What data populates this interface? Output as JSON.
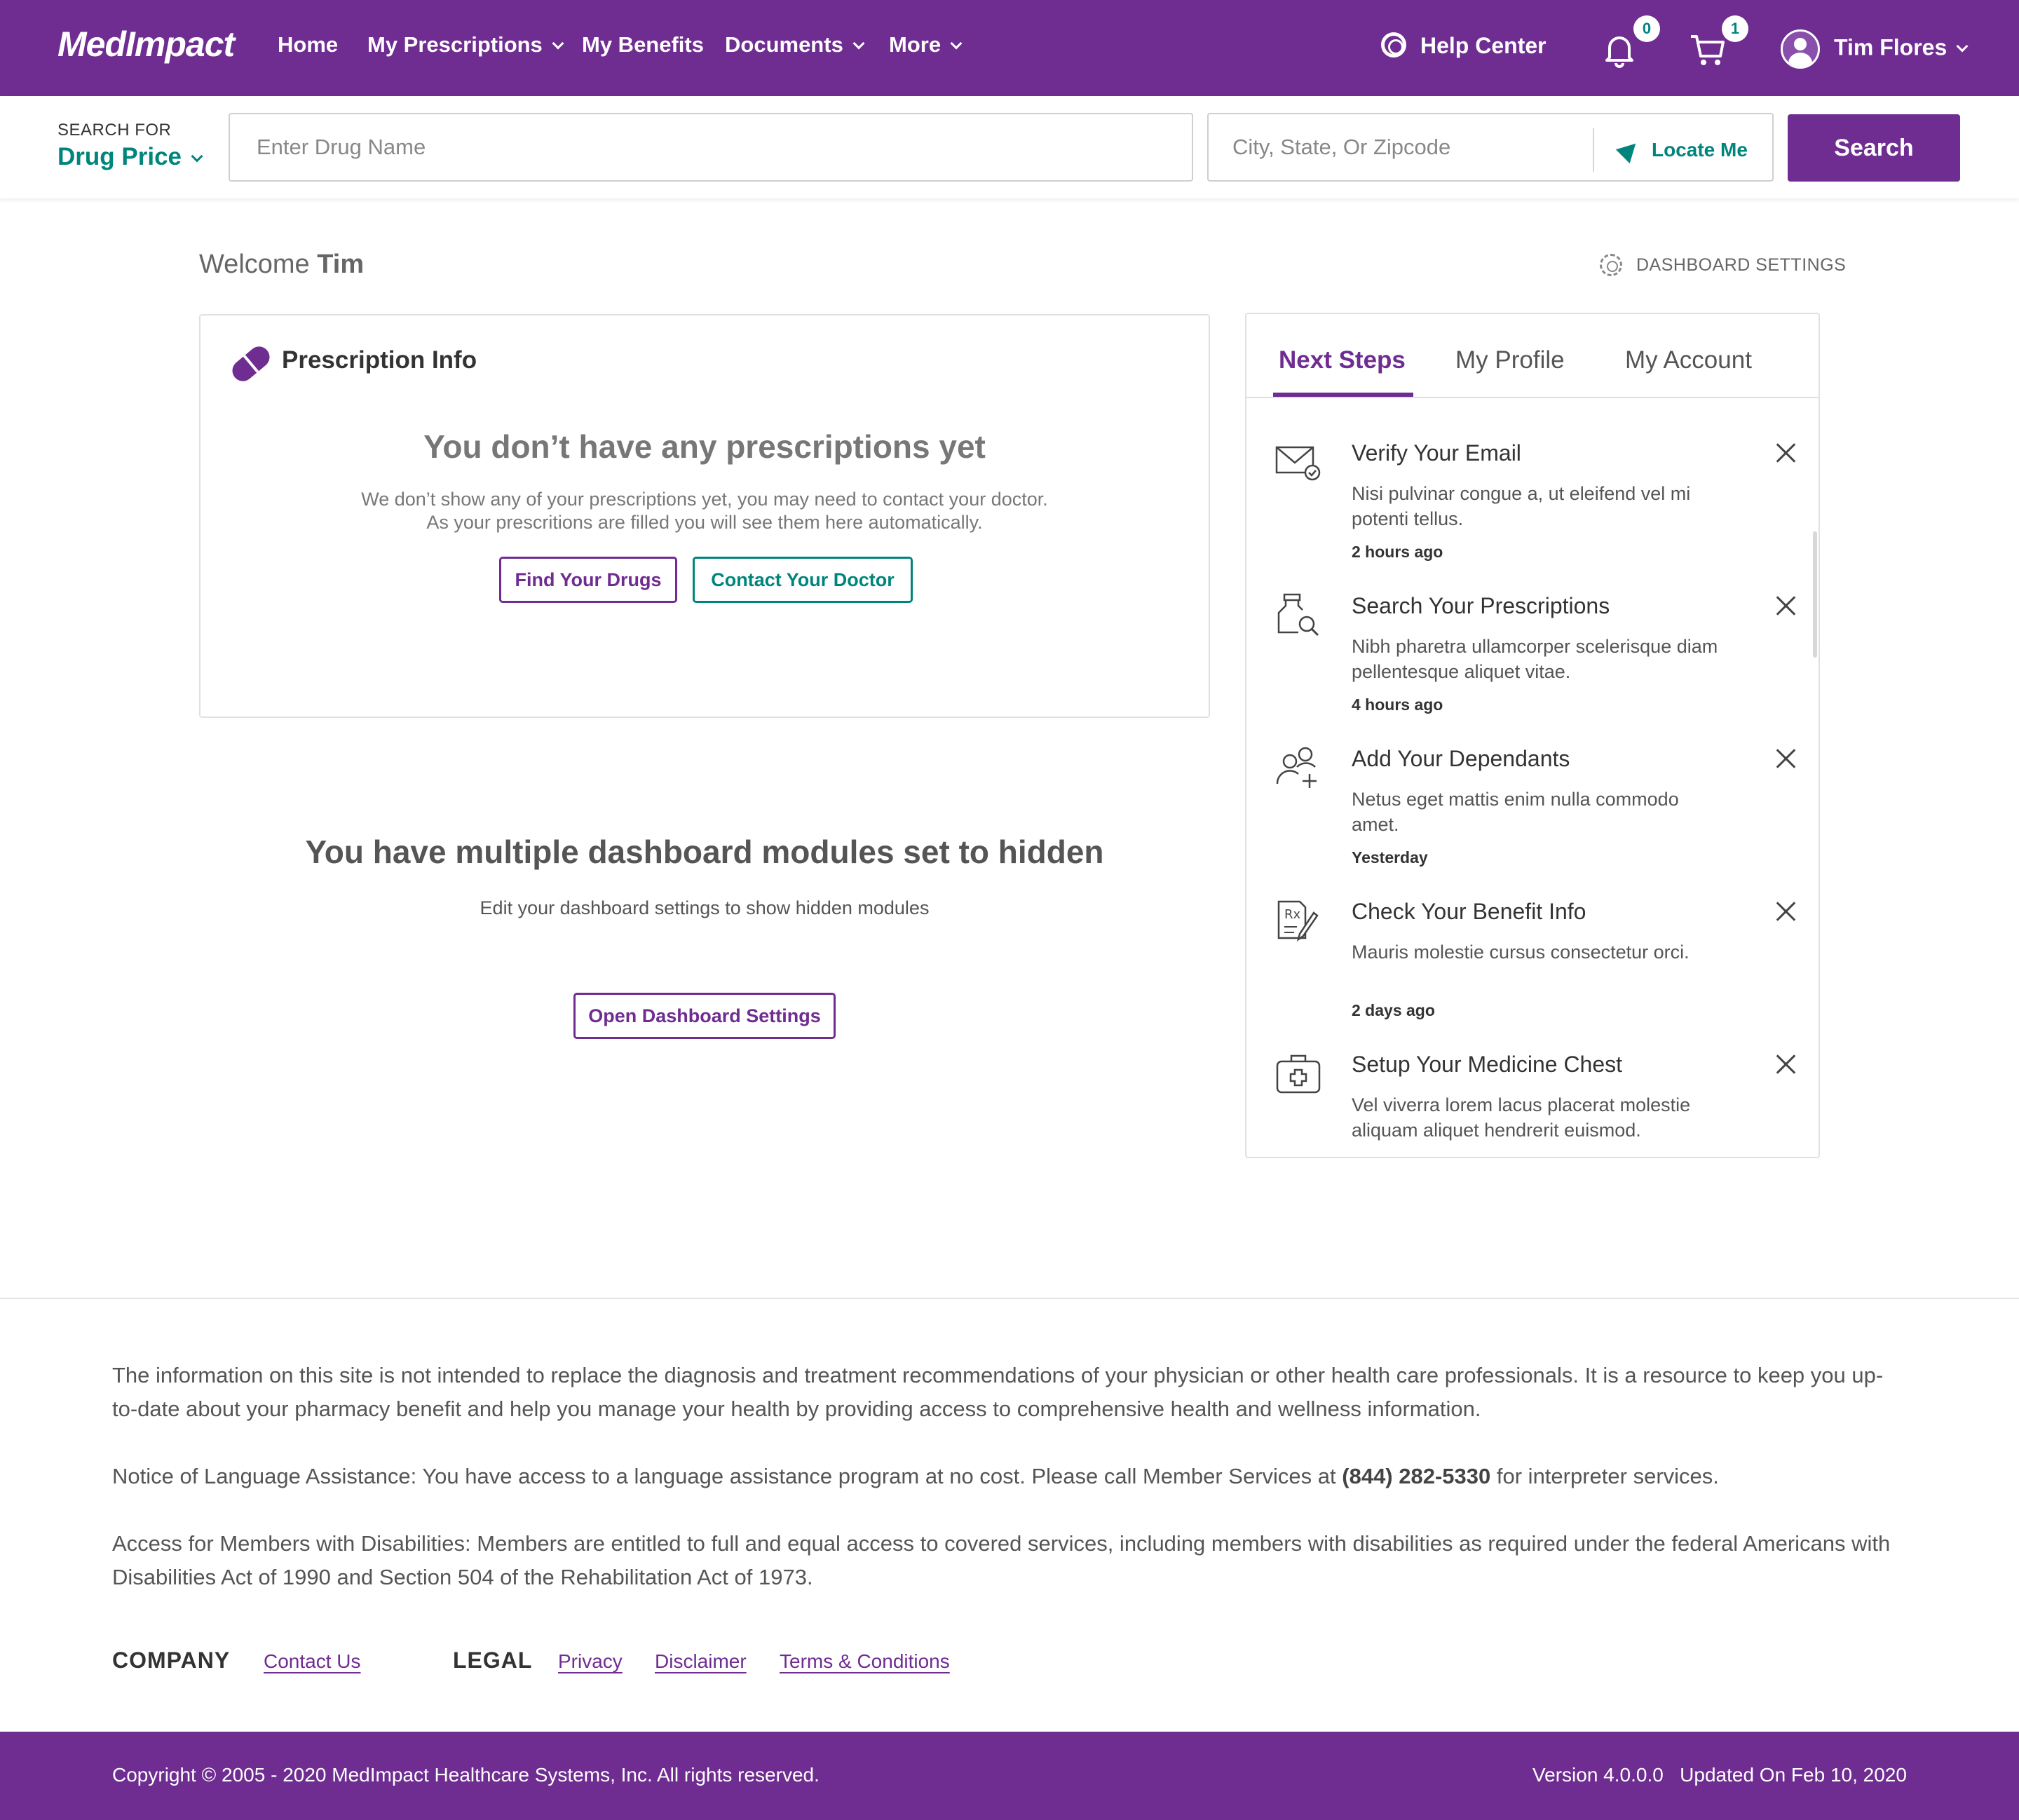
{
  "brand": {
    "logo_text": "MedImpact",
    "accent": "#6f2c91",
    "teal": "#00857c"
  },
  "nav": {
    "items": [
      {
        "label": "Home",
        "dropdown": false
      },
      {
        "label": "My Prescriptions",
        "dropdown": true
      },
      {
        "label": "My Benefits",
        "dropdown": false
      },
      {
        "label": "Documents",
        "dropdown": true
      },
      {
        "label": "More",
        "dropdown": true
      }
    ],
    "help_label": "Help Center",
    "notifications_count": "0",
    "cart_count": "1",
    "user_name": "Tim Flores"
  },
  "search": {
    "label": "SEARCH FOR",
    "type_selected": "Drug Price",
    "drug_placeholder": "Enter Drug Name",
    "location_placeholder": "City, State, Or Zipcode",
    "locate_label": "Locate Me",
    "button_label": "Search"
  },
  "welcome": {
    "prefix": "Welcome",
    "name": "Tim"
  },
  "dashboard_settings_label": "DASHBOARD SETTINGS",
  "prescription_card": {
    "title": "Prescription Info",
    "empty_title": "You don’t have any prescriptions yet",
    "empty_desc_line1": "We don’t show any of your prescriptions yet, you may need to contact your doctor.",
    "empty_desc_line2": "As your prescritions are filled you will see them here automatically.",
    "find_button": "Find Your Drugs",
    "contact_button": "Contact Your Doctor"
  },
  "hidden_modules": {
    "title": "You have multiple dashboard modules set to hidden",
    "desc": "Edit your dashboard settings to show hidden modules",
    "button": "Open Dashboard Settings"
  },
  "panel": {
    "tabs": [
      {
        "label": "Next Steps",
        "active": true
      },
      {
        "label": "My Profile",
        "active": false
      },
      {
        "label": "My Account",
        "active": false
      }
    ],
    "steps": [
      {
        "icon": "envelope-check-icon",
        "title": "Verify Your Email",
        "desc": "Nisi pulvinar congue a, ut eleifend vel mi potenti tellus.",
        "time": "2 hours ago"
      },
      {
        "icon": "bottle-search-icon",
        "title": "Search Your Prescriptions",
        "desc": "Nibh pharetra ullamcorper scelerisque diam pellentesque aliquet vitae.",
        "time": "4 hours ago"
      },
      {
        "icon": "add-users-icon",
        "title": "Add Your Dependants",
        "desc": "Netus eget mattis enim nulla commodo amet.",
        "time": "Yesterday"
      },
      {
        "icon": "rx-document-icon",
        "title": "Check Your Benefit Info",
        "desc": "Mauris molestie cursus consectetur orci.",
        "time": "2 days ago"
      },
      {
        "icon": "medicine-chest-icon",
        "title": "Setup Your Medicine Chest",
        "desc": "Vel viverra lorem lacus placerat molestie aliquam aliquet hendrerit euismod.",
        "time": ""
      }
    ]
  },
  "footer": {
    "disclaimer": "The information on this site is not intended to replace the diagnosis and treatment recommendations of your physician or other health care professionals. It is a resource to keep you up-to-date about your pharmacy benefit and help you manage your health by providing access to comprehensive health and wellness information.",
    "language_prefix": "Notice of Language Assistance: You have access to a language assistance program at no cost. Please call Member Services at",
    "phone": "(844) 282-5330",
    "language_suffix": "for interpreter services.",
    "disabilities": "Access for Members with Disabilities: Members are entitled to full and equal access to covered services, including members with disabilities as required under the federal Americans with Disabilities Act of 1990 and Section 504 of the Rehabilitation Act of 1973.",
    "company_heading": "COMPANY",
    "contact_link": "Contact Us",
    "legal_heading": "LEGAL",
    "privacy_link": "Privacy",
    "disclaimer_link": "Disclaimer",
    "terms_link": "Terms & Conditions",
    "copyright": "Copyright © 2005 - 2020 MedImpact Healthcare Systems, Inc. All rights reserved.",
    "version": "Version 4.0.0.0",
    "updated": "Updated On Feb 10, 2020"
  }
}
